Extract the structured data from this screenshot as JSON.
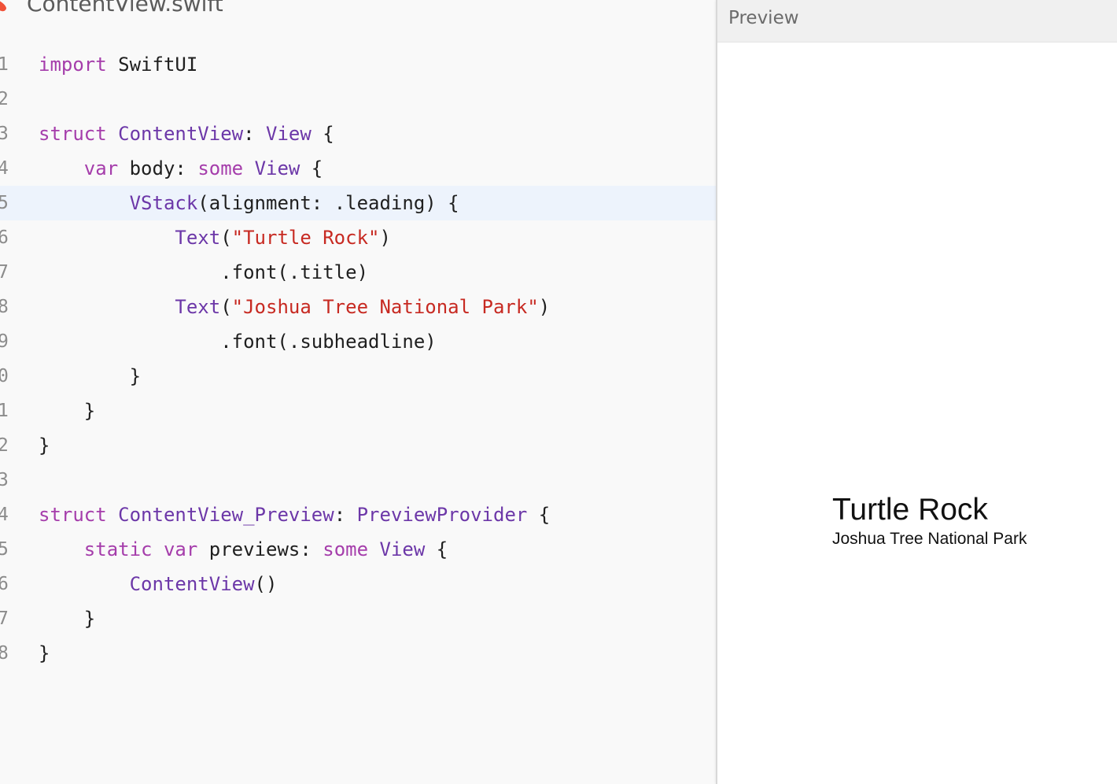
{
  "editor": {
    "file_name": "ContentView.swift",
    "current_line": 5,
    "lines": [
      {
        "number": "1",
        "tokens": [
          {
            "t": "import",
            "k": "kw"
          },
          {
            "t": " SwiftUI",
            "k": "plain"
          }
        ]
      },
      {
        "number": "2",
        "tokens": []
      },
      {
        "number": "3",
        "tokens": [
          {
            "t": "struct",
            "k": "kw"
          },
          {
            "t": " ",
            "k": "plain"
          },
          {
            "t": "ContentView",
            "k": "type"
          },
          {
            "t": ": ",
            "k": "plain"
          },
          {
            "t": "View",
            "k": "type"
          },
          {
            "t": " {",
            "k": "plain"
          }
        ]
      },
      {
        "number": "4",
        "tokens": [
          {
            "t": "    ",
            "k": "plain"
          },
          {
            "t": "var",
            "k": "kw"
          },
          {
            "t": " body: ",
            "k": "plain"
          },
          {
            "t": "some",
            "k": "kw"
          },
          {
            "t": " ",
            "k": "plain"
          },
          {
            "t": "View",
            "k": "type"
          },
          {
            "t": " {",
            "k": "plain"
          }
        ]
      },
      {
        "number": "5",
        "tokens": [
          {
            "t": "        ",
            "k": "plain"
          },
          {
            "t": "VStack",
            "k": "type"
          },
          {
            "t": "(alignment: .leading) {",
            "k": "plain"
          }
        ]
      },
      {
        "number": "6",
        "tokens": [
          {
            "t": "            ",
            "k": "plain"
          },
          {
            "t": "Text",
            "k": "type"
          },
          {
            "t": "(",
            "k": "plain"
          },
          {
            "t": "\"Turtle Rock\"",
            "k": "str"
          },
          {
            "t": ")",
            "k": "plain"
          }
        ]
      },
      {
        "number": "7",
        "tokens": [
          {
            "t": "                .font(.title)",
            "k": "plain"
          }
        ]
      },
      {
        "number": "8",
        "tokens": [
          {
            "t": "            ",
            "k": "plain"
          },
          {
            "t": "Text",
            "k": "type"
          },
          {
            "t": "(",
            "k": "plain"
          },
          {
            "t": "\"Joshua Tree National Park\"",
            "k": "str"
          },
          {
            "t": ")",
            "k": "plain"
          }
        ]
      },
      {
        "number": "9",
        "tokens": [
          {
            "t": "                .font(.subheadline)",
            "k": "plain"
          }
        ]
      },
      {
        "number": "0",
        "tokens": [
          {
            "t": "        }",
            "k": "plain"
          }
        ]
      },
      {
        "number": "1",
        "tokens": [
          {
            "t": "    }",
            "k": "plain"
          }
        ]
      },
      {
        "number": "2",
        "tokens": [
          {
            "t": "}",
            "k": "plain"
          }
        ]
      },
      {
        "number": "3",
        "tokens": []
      },
      {
        "number": "4",
        "tokens": [
          {
            "t": "struct",
            "k": "kw"
          },
          {
            "t": " ",
            "k": "plain"
          },
          {
            "t": "ContentView_Preview",
            "k": "type"
          },
          {
            "t": ": ",
            "k": "plain"
          },
          {
            "t": "PreviewProvider",
            "k": "type"
          },
          {
            "t": " {",
            "k": "plain"
          }
        ]
      },
      {
        "number": "5",
        "tokens": [
          {
            "t": "    ",
            "k": "plain"
          },
          {
            "t": "static",
            "k": "kw"
          },
          {
            "t": " ",
            "k": "plain"
          },
          {
            "t": "var",
            "k": "kw"
          },
          {
            "t": " previews: ",
            "k": "plain"
          },
          {
            "t": "some",
            "k": "kw"
          },
          {
            "t": " ",
            "k": "plain"
          },
          {
            "t": "View",
            "k": "type"
          },
          {
            "t": " {",
            "k": "plain"
          }
        ]
      },
      {
        "number": "6",
        "tokens": [
          {
            "t": "        ",
            "k": "plain"
          },
          {
            "t": "ContentView",
            "k": "type"
          },
          {
            "t": "()",
            "k": "plain"
          }
        ]
      },
      {
        "number": "7",
        "tokens": [
          {
            "t": "    }",
            "k": "plain"
          }
        ]
      },
      {
        "number": "8",
        "tokens": [
          {
            "t": "}",
            "k": "plain"
          }
        ]
      }
    ]
  },
  "preview": {
    "title": "Preview",
    "heading": "Turtle Rock",
    "subheading": "Joshua Tree National Park"
  },
  "colors": {
    "keyword": "#a53dab",
    "type": "#6c37a8",
    "string": "#c72a22",
    "plain": "#1f1f1f",
    "current_line_highlight": "#edf3fc"
  },
  "icons": {
    "file_icon": "swift-icon"
  }
}
